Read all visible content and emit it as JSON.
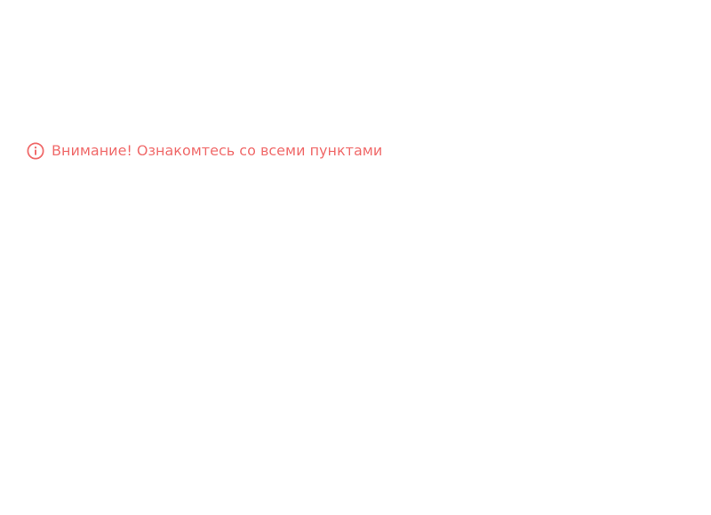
{
  "warning": {
    "icon": "info-circle-icon",
    "color": "#f06a6a",
    "text": "Внимание! Ознакомтесь со всеми пунктами"
  },
  "items": [
    "",
    "",
    "",
    "",
    "",
    "",
    ""
  ],
  "colors": {
    "background": "#ffffff",
    "faded_text": "#fbfbfb"
  }
}
